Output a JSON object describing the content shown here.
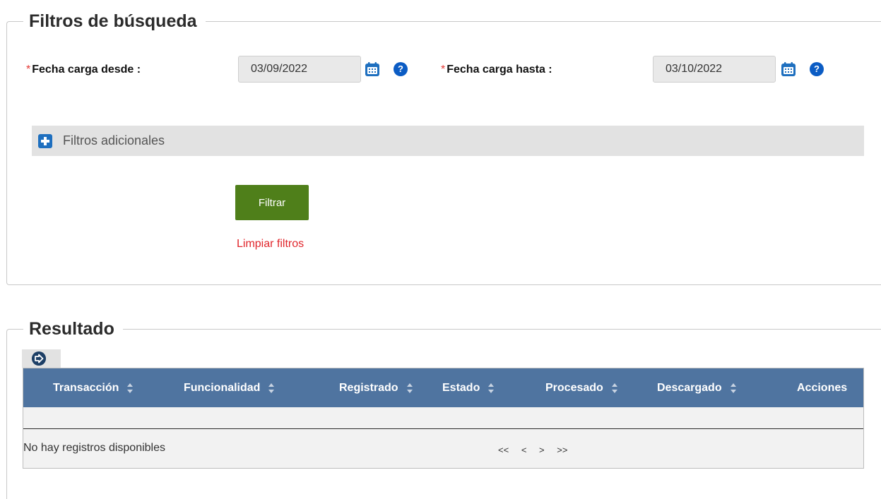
{
  "filters": {
    "legend": "Filtros de búsqueda",
    "required_mark": "*",
    "date_from": {
      "label": "Fecha carga desde :",
      "value": "03/09/2022"
    },
    "date_to": {
      "label": "Fecha carga hasta :",
      "value": "03/10/2022"
    },
    "help_glyph": "?",
    "additional_label": "Filtros adicionales",
    "filter_button": "Filtrar",
    "clear_link": "Limpiar filtros"
  },
  "results": {
    "legend": "Resultado",
    "columns": [
      "Transacción",
      "Funcionalidad",
      "Registrado",
      "Estado",
      "Procesado",
      "Descargado",
      "Acciones"
    ],
    "empty_message": "No hay registros disponibles",
    "pager": {
      "first": "<<",
      "prev": "<",
      "next": ">",
      "last": ">>"
    }
  },
  "colors": {
    "header_bg": "#4f74a0",
    "filter_button_bg": "#4f7f1a",
    "clear_link": "#e0252b",
    "help_icon": "#0b5cc4",
    "required_mark": "#e53935"
  },
  "icons": [
    "calendar-icon",
    "help-icon",
    "plus-icon",
    "export-icon",
    "sort-icon"
  ]
}
